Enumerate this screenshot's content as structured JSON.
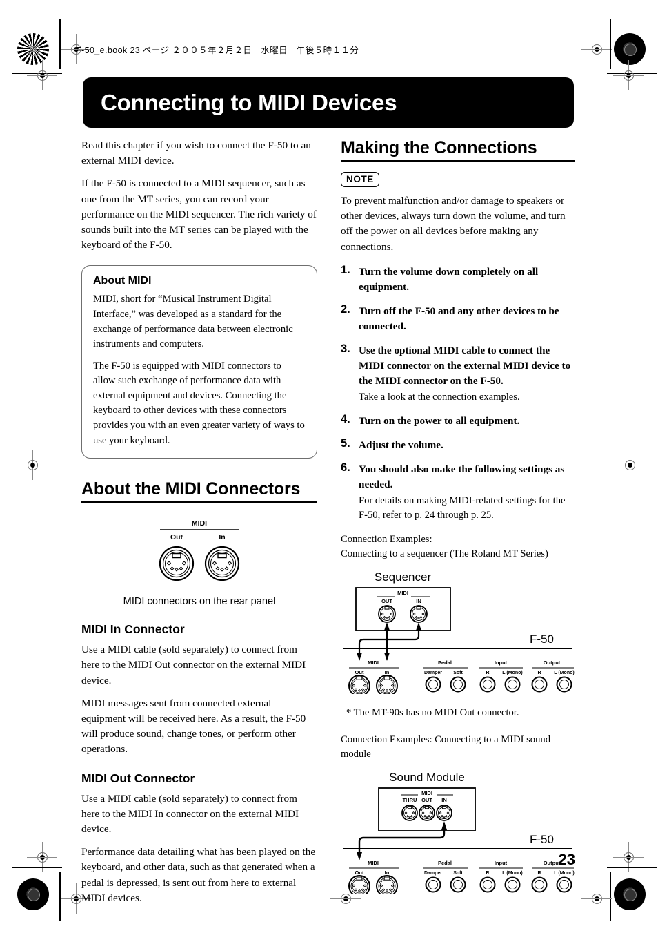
{
  "print_header": "F-50_e.book  23 ページ  ２００５年２月２日　水曜日　午後５時１１分",
  "page_title": "Connecting to MIDI Devices",
  "page_number": "23",
  "left_column": {
    "intro_paragraphs": [
      "Read this chapter if you wish to connect the F-50 to an external MIDI device.",
      "If the F-50 is connected to a MIDI sequencer, such as one from the MT series, you can record your performance on the MIDI sequencer. The rich variety of sounds built into the MT series can be played with the keyboard of the F-50."
    ],
    "about_box": {
      "heading": "About MIDI",
      "paragraphs": [
        "MIDI, short for “Musical Instrument Digital Interface,” was developed as a standard for the exchange of performance data between electronic instruments and computers.",
        "The F-50 is equipped with MIDI connectors to allow such exchange of performance data with external equipment and devices. Connecting the keyboard to other devices with these connectors provides you with an even greater variety of ways to use your keyboard."
      ]
    },
    "section_heading": "About the MIDI Connectors",
    "rear_panel_figure": {
      "group_label": "MIDI",
      "jack_left": "Out",
      "jack_right": "In",
      "caption": "MIDI connectors on the rear panel"
    },
    "midi_in": {
      "heading": "MIDI In Connector",
      "paragraphs": [
        "Use a MIDI cable (sold separately) to connect from here to the MIDI Out connector on the external MIDI device.",
        "MIDI messages sent from connected external equipment will be received here. As a result, the F-50 will produce sound, change tones, or perform other operations."
      ]
    },
    "midi_out": {
      "heading": "MIDI Out Connector",
      "paragraphs": [
        "Use a MIDI cable (sold separately) to connect from here to the MIDI In connector on the external MIDI device.",
        "Performance data detailing what has been played on the keyboard, and other data, such as that generated when a pedal is depressed, is sent out from here to external MIDI devices."
      ]
    }
  },
  "right_column": {
    "section_heading": "Making the Connections",
    "note_badge": "NOTE",
    "note_text": "To prevent malfunction and/or damage to speakers or other devices, always turn down the volume, and turn off the power on all devices before making any connections.",
    "steps": [
      {
        "num": "1.",
        "text": "Turn the volume down completely on all equipment.",
        "sub": ""
      },
      {
        "num": "2.",
        "text": "Turn off the F-50 and any other devices to be connected.",
        "sub": ""
      },
      {
        "num": "3.",
        "text": "Use the optional MIDI cable to connect the MIDI connector on the external MIDI device to the MIDI connector on the F-50.",
        "sub": "Take a look at the connection examples."
      },
      {
        "num": "4.",
        "text": "Turn on the power to all equipment.",
        "sub": ""
      },
      {
        "num": "5.",
        "text": "Adjust the volume.",
        "sub": ""
      },
      {
        "num": "6.",
        "text": "You should also make the following settings as needed.",
        "sub": "For details on making MIDI-related settings for the F-50, refer to p. 24 through p. 25."
      }
    ],
    "example1_label_a": "Connection Examples:",
    "example1_label_b": "Connecting to a sequencer (The Roland MT Series)",
    "sequencer_figure": {
      "device_title": "Sequencer",
      "device_group_label": "MIDI",
      "device_jack_left": "OUT",
      "device_jack_right": "IN",
      "unit_label": "F-50",
      "panel_groups": [
        {
          "group": "MIDI",
          "jacks": [
            "Out",
            "In"
          ]
        },
        {
          "group": "Pedal",
          "jacks": [
            "Damper",
            "Soft"
          ]
        },
        {
          "group": "Input",
          "jacks": [
            "R",
            "L (Mono)"
          ]
        },
        {
          "group": "Output",
          "jacks": [
            "R",
            "L (Mono)"
          ]
        }
      ]
    },
    "footnote": "* The MT-90s has no MIDI Out connector.",
    "example2_label": "Connection Examples: Connecting to a MIDI sound module",
    "sound_module_figure": {
      "device_title": "Sound Module",
      "device_group_label": "MIDI",
      "device_jacks": [
        "THRU",
        "OUT",
        "IN"
      ],
      "unit_label": "F-50",
      "panel_groups": [
        {
          "group": "MIDI",
          "jacks": [
            "Out",
            "In"
          ]
        },
        {
          "group": "Pedal",
          "jacks": [
            "Damper",
            "Soft"
          ]
        },
        {
          "group": "Input",
          "jacks": [
            "R",
            "L (Mono)"
          ]
        },
        {
          "group": "Output",
          "jacks": [
            "R",
            "L (Mono)"
          ]
        }
      ]
    }
  },
  "colors": {
    "title_bar_bg": "#000000",
    "title_bar_text": "#ffffff",
    "box_border": "#6f6f6f",
    "rule": "#000000"
  }
}
